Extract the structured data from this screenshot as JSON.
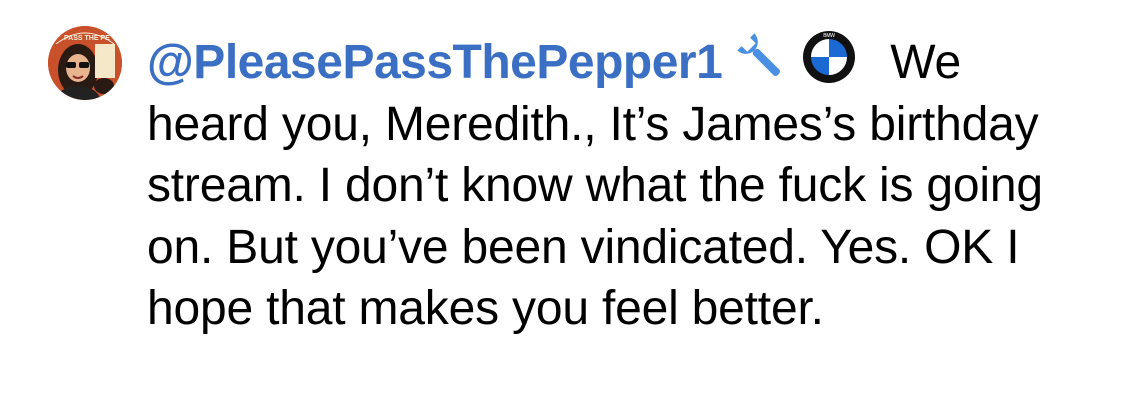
{
  "comment": {
    "username": "@PleasePassThePepper1",
    "first_word": "We",
    "body": "heard you, Meredith., It’s James’s birthday stream. I don’t know what the fuck is going on. But you’ve been vindicated. Yes. OK I hope that makes you feel better.",
    "avatar_text": "PASS THE PEPPER",
    "badges": [
      "wrench-icon",
      "bmw-roundel-icon"
    ]
  },
  "colors": {
    "username": "#3a6fc4",
    "text": "#000000",
    "background": "#ffffff",
    "wrench": "#4a90e2"
  }
}
